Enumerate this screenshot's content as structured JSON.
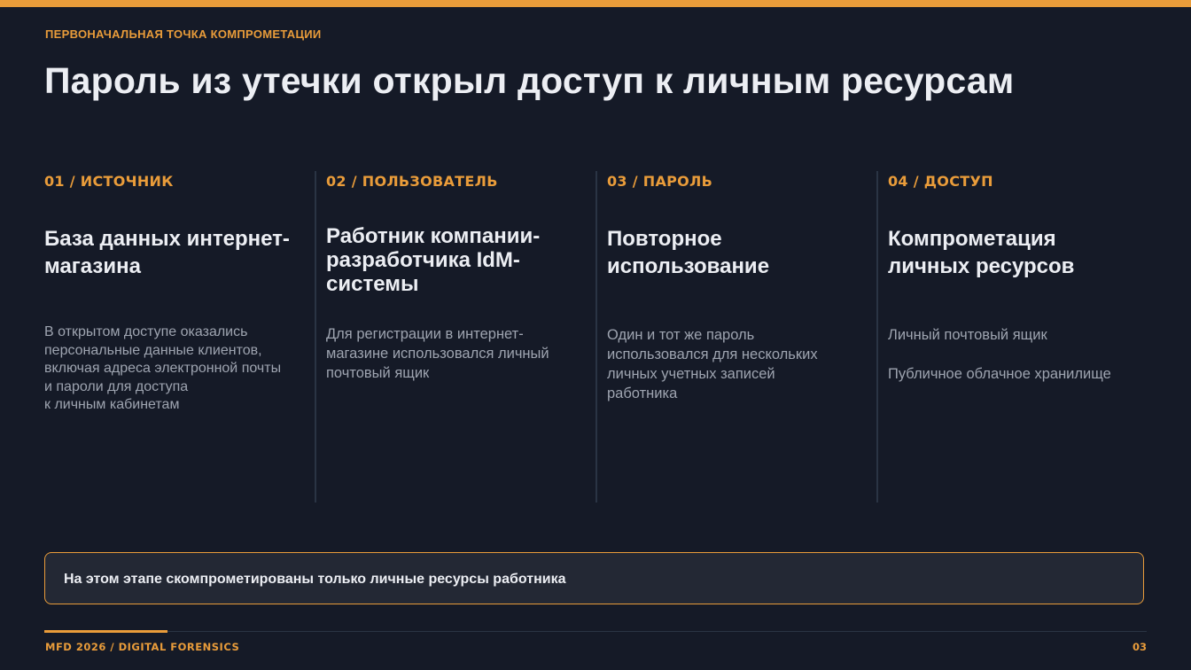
{
  "slide": {
    "eyebrow": "ПЕРВОНАЧАЛЬНАЯ ТОЧКА КОМПРОМЕТАЦИИ",
    "title": "Пароль из утечки открыл доступ к личным ресурсам"
  },
  "columns": [
    {
      "label": "01 / ИСТОЧНИК",
      "heading": "База данных интернет-магазина",
      "body": [
        "В открытом доступе оказались",
        "персональные данные клиентов,",
        "включая адреса электронной почты",
        "и пароли для доступа",
        "к личным кабинетам"
      ]
    },
    {
      "label": "02 / ПОЛЬЗОВАТЕЛЬ",
      "heading": "Работник компании-разработчика IdM-системы",
      "body": [
        "Для регистрации в интернет-",
        "магазине использовался личный",
        "почтовый ящик"
      ]
    },
    {
      "label": "03 / ПАРОЛЬ",
      "heading": "Повторное использование",
      "body": [
        "Один и тот же пароль",
        "использовался для нескольких",
        "личных учетных записей",
        "работника"
      ]
    },
    {
      "label": "04 / ДОСТУП",
      "heading": "Компрометация личных ресурсов",
      "body": [
        "Личный почтовый ящик",
        "Публичное облачное хранилище"
      ]
    }
  ],
  "callout": {
    "text": "На этом этапе скомпрометированы только личные ресурсы работника"
  },
  "footer": {
    "left": "MFD 2026 / DIGITAL FORENSICS",
    "page_number": "03"
  },
  "colors": {
    "background": "#151a27",
    "accent": "#e99c3a",
    "heading": "#eceef3",
    "body_text": "#9ea4b0",
    "separator": "#2a3444"
  }
}
